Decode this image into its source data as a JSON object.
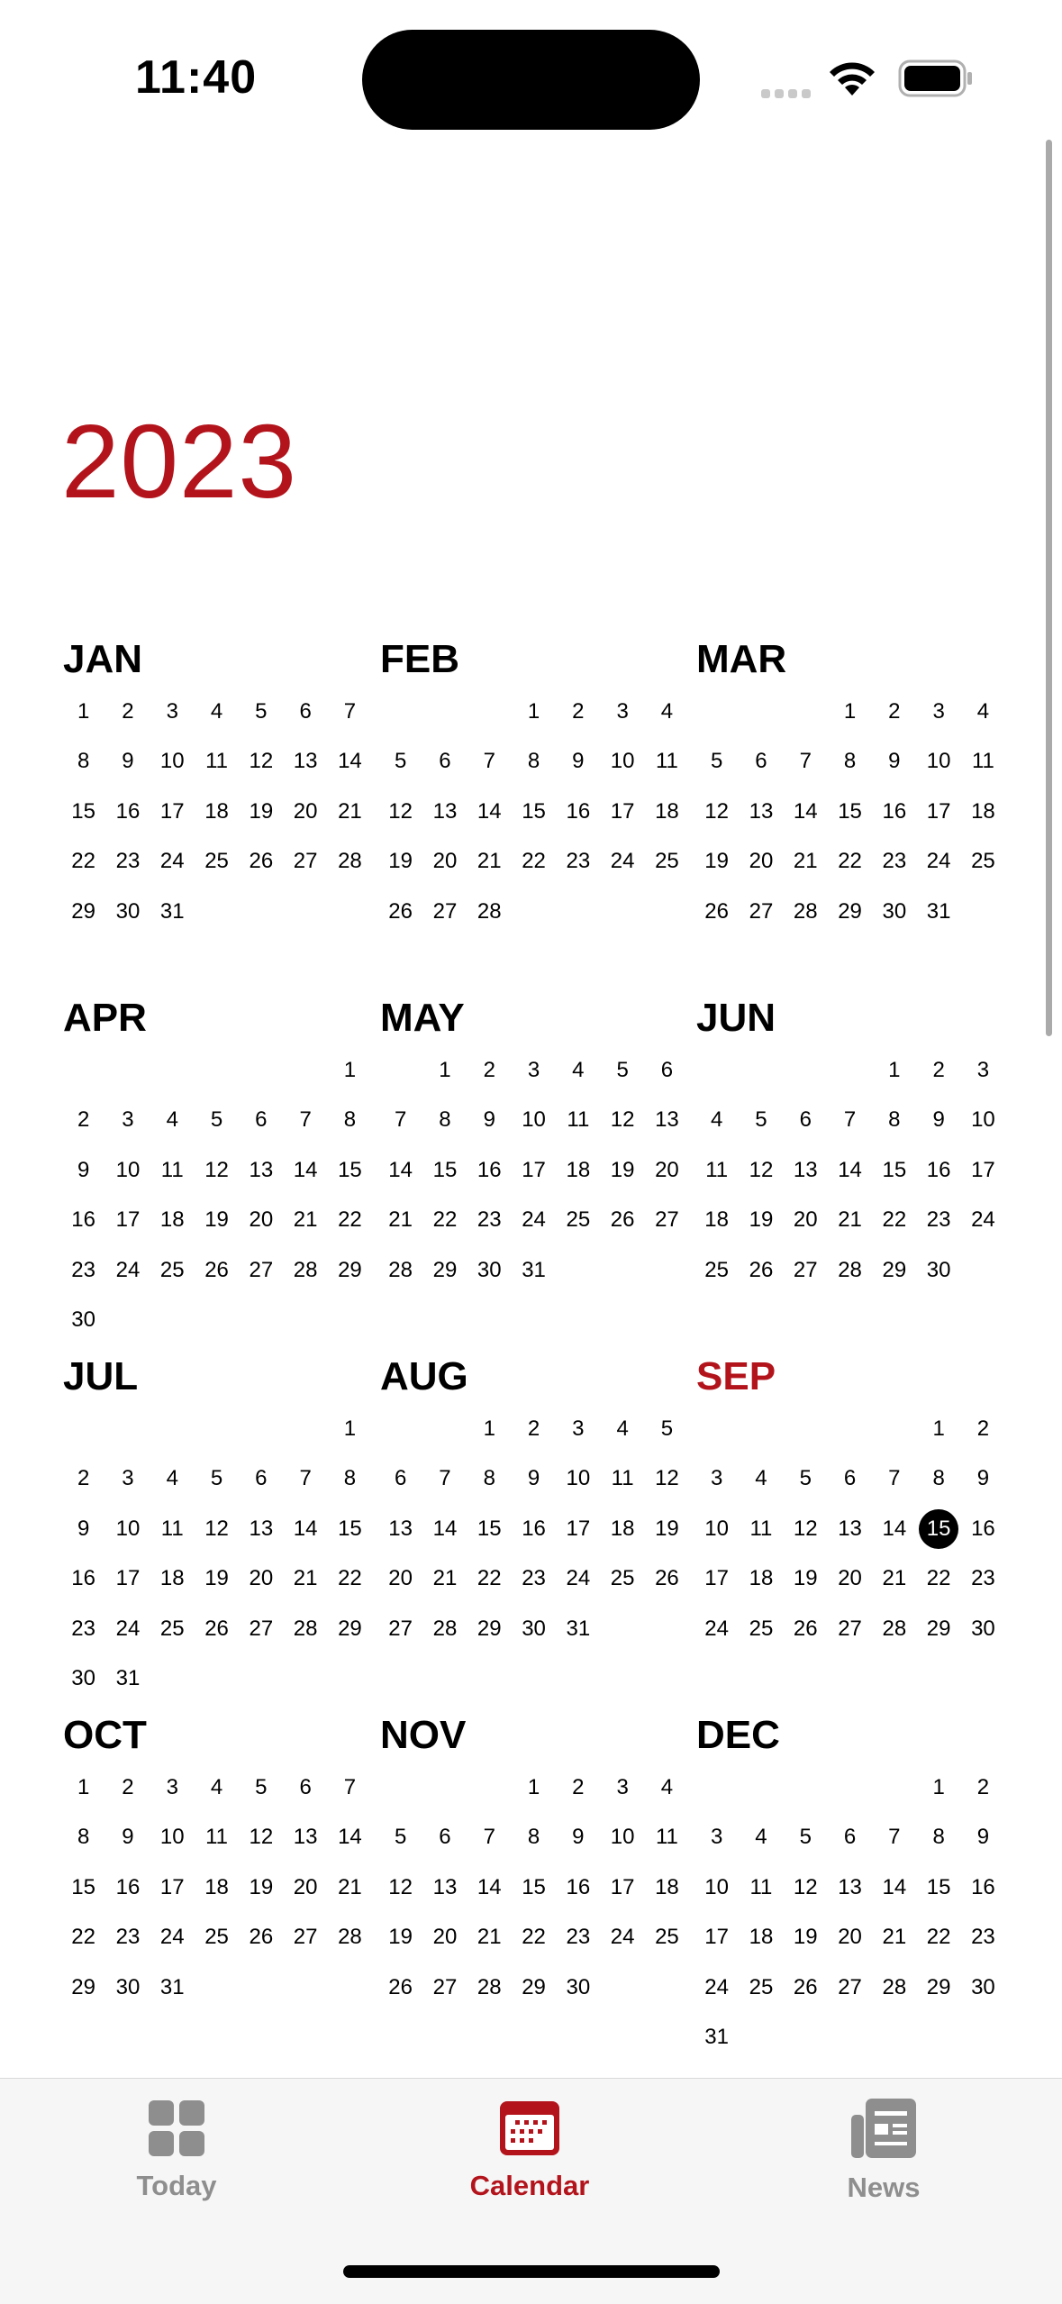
{
  "status_bar": {
    "time": "11:40"
  },
  "year": "2023",
  "months": [
    {
      "name": "JAN",
      "offset": 0,
      "days": 31
    },
    {
      "name": "FEB",
      "offset": 3,
      "days": 28
    },
    {
      "name": "MAR",
      "offset": 3,
      "days": 31
    },
    {
      "name": "APR",
      "offset": 6,
      "days": 30
    },
    {
      "name": "MAY",
      "offset": 1,
      "days": 31
    },
    {
      "name": "JUN",
      "offset": 4,
      "days": 30
    },
    {
      "name": "JUL",
      "offset": 6,
      "days": 31
    },
    {
      "name": "AUG",
      "offset": 2,
      "days": 31
    },
    {
      "name": "SEP",
      "offset": 5,
      "days": 30,
      "current": true,
      "today": 15
    },
    {
      "name": "OCT",
      "offset": 0,
      "days": 31
    },
    {
      "name": "NOV",
      "offset": 3,
      "days": 30
    },
    {
      "name": "DEC",
      "offset": 5,
      "days": 31
    }
  ],
  "tabs": [
    {
      "label": "Today",
      "icon": "grid-icon",
      "active": false
    },
    {
      "label": "Calendar",
      "icon": "calendar-icon",
      "active": true
    },
    {
      "label": "News",
      "icon": "newspaper-icon",
      "active": false
    }
  ],
  "colors": {
    "accent": "#b3141c",
    "inactive": "#8e8e8e"
  }
}
